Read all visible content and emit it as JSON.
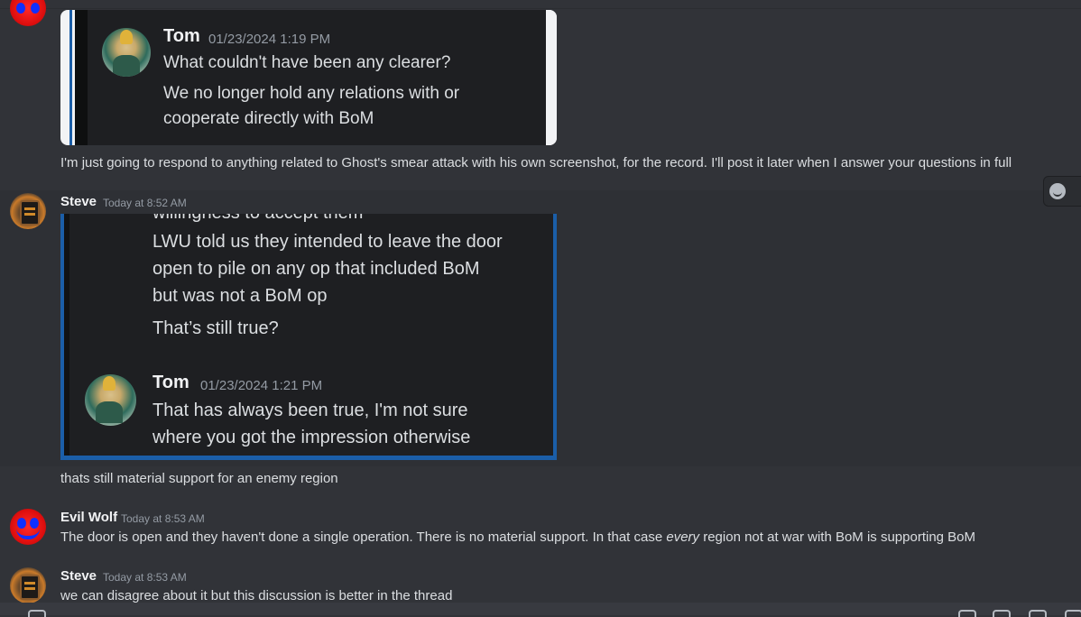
{
  "messages": {
    "m0": {
      "text": "I'm just going to respond to anything related to Ghost's smear attack with his own screenshot, for the record. I'll post it later when I answer your questions in full"
    },
    "m1": {
      "username": "Steve",
      "timestamp": "Today at 8:52 AM",
      "text": "thats still material support for an enemy region"
    },
    "m2": {
      "username": "Evil Wolf",
      "timestamp": "Today at 8:53 AM",
      "text_before": "The door is open and they haven't done a single operation. There is no material support. In that case ",
      "text_em": "every",
      "text_after": " region not at war with BoM is supporting BoM"
    },
    "m3": {
      "username": "Steve",
      "timestamp": "Today at 8:53 AM",
      "text": "we can disagree about it but this discussion is better in the thread"
    }
  },
  "screenshot1": {
    "name": "Tom",
    "time": "01/23/2024 1:19 PM",
    "line1": "What couldn't have been any clearer?",
    "line2": "We no longer hold any relations with or",
    "line3": "cooperate directly with BoM"
  },
  "screenshot2": {
    "cut_line": "willingness to accept them",
    "line1": "LWU told us they intended to leave the door",
    "line2": "open to pile on any op that included BoM",
    "line3": "but was not a BoM op",
    "line4": "That’s still true?",
    "name": "Tom",
    "time": "01/23/2024 1:21 PM",
    "reply1": "That has always been true, I'm not sure",
    "reply2": "where you got the impression otherwise"
  },
  "icons": {
    "react": "smile-icon",
    "avatar_wolf": "wolf-avatar",
    "avatar_steve": "steve-avatar"
  }
}
